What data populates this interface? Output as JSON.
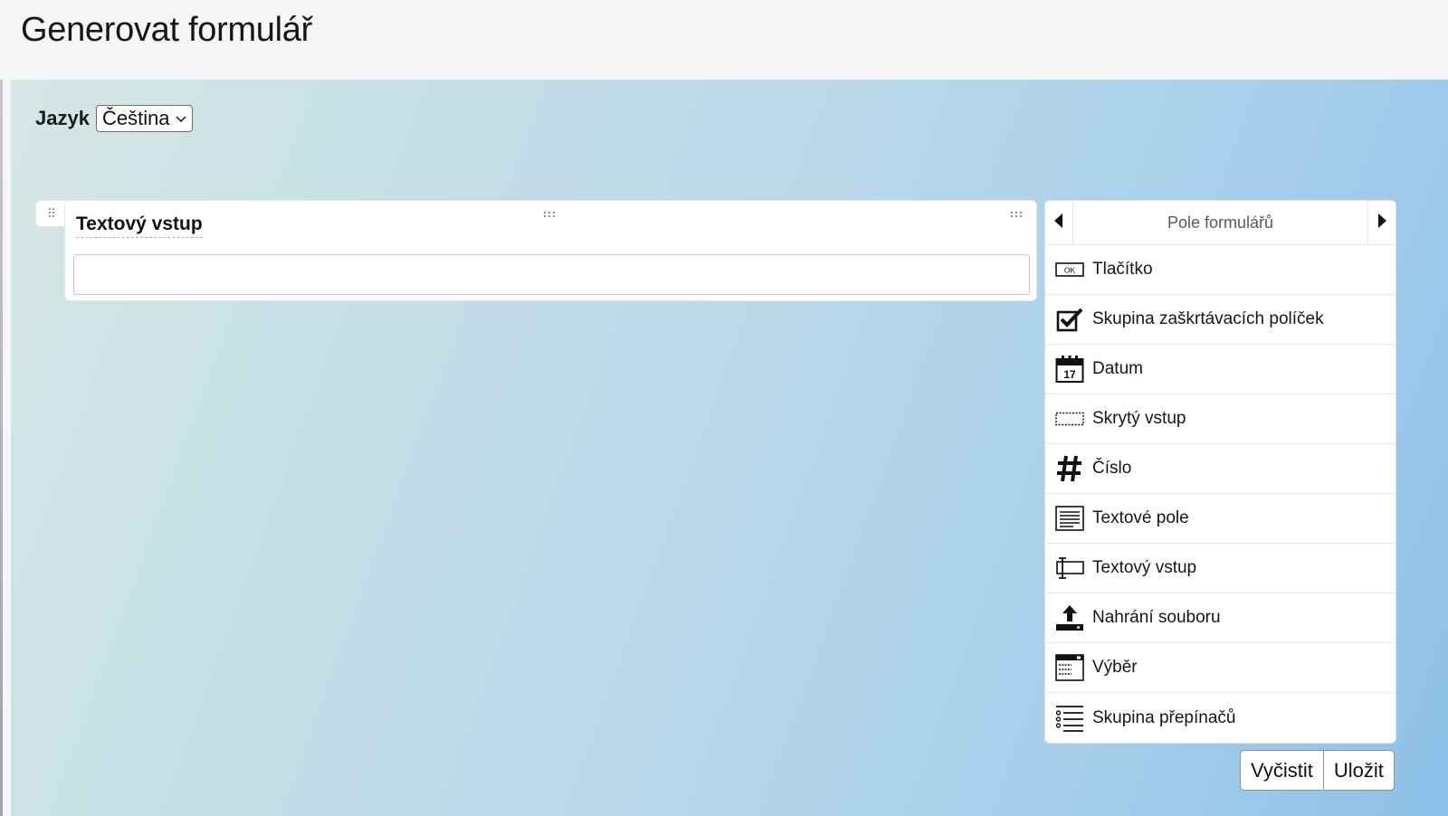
{
  "page": {
    "title": "Generovat formulář"
  },
  "language": {
    "label": "Jazyk",
    "selected": "Čeština"
  },
  "field": {
    "label": "Textový vstup",
    "value": ""
  },
  "palette": {
    "title": "Pole formulářů",
    "items": [
      {
        "label": "Tlačítko",
        "icon": "button-icon"
      },
      {
        "label": "Skupina zaškrtávacích políček",
        "icon": "checkbox-group-icon"
      },
      {
        "label": "Datum",
        "icon": "calendar-icon"
      },
      {
        "label": "Skrytý vstup",
        "icon": "hidden-input-icon"
      },
      {
        "label": "Číslo",
        "icon": "number-icon"
      },
      {
        "label": "Textové pole",
        "icon": "textarea-icon"
      },
      {
        "label": "Textový vstup",
        "icon": "text-input-icon"
      },
      {
        "label": "Nahrání souboru",
        "icon": "file-upload-icon"
      },
      {
        "label": "Výběr",
        "icon": "select-icon"
      },
      {
        "label": "Skupina přepínačů",
        "icon": "radio-group-icon"
      }
    ]
  },
  "icon_text": {
    "button": "OK",
    "calendar_day": "17"
  },
  "actions": {
    "clear": "Vyčistit",
    "save": "Uložit"
  }
}
